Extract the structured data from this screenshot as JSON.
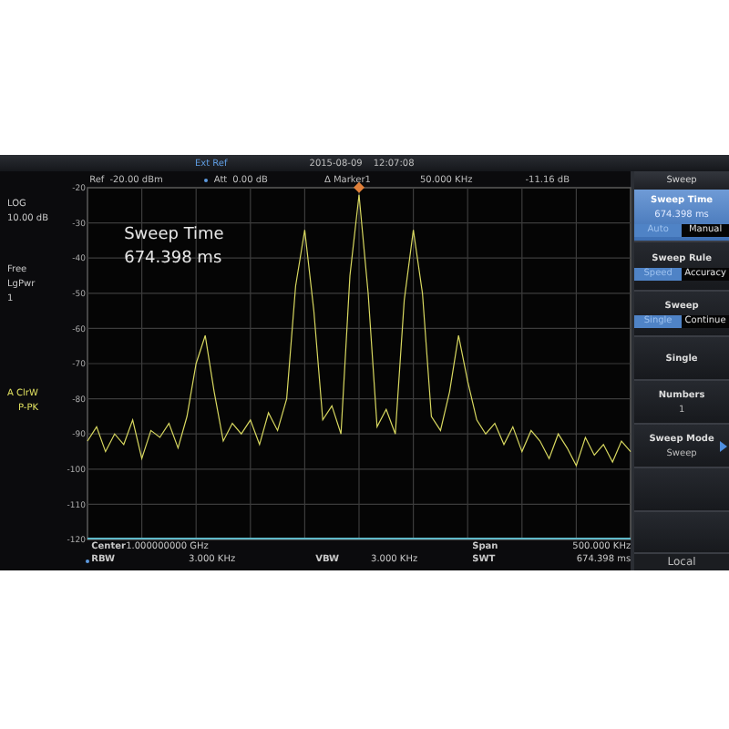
{
  "top_bar": {
    "reference": "Ext Ref",
    "date": "2015-08-09",
    "time": "12:07:08"
  },
  "left_panel": {
    "scale": "LOG",
    "scale_value": "10.00 dB",
    "trigger": "Free",
    "detector": "LgPwr",
    "average": "1",
    "trace_label": "A",
    "trace_mode": "ClrW",
    "trace_detector": "P-PK"
  },
  "plot": {
    "ref_label": "Ref",
    "ref_value": "-20.00 dBm",
    "att_label": "Att",
    "att_value": "0.00 dB",
    "marker_label": "Δ Marker1",
    "marker_freq": "50.000 KHz",
    "marker_value": "-11.16 dB",
    "chart_data": {
      "type": "line",
      "grid": true,
      "ylim": [
        -120,
        -20
      ],
      "yticks": [
        -20,
        -30,
        -40,
        -50,
        -60,
        -70,
        -80,
        -90,
        -100,
        -110,
        -120
      ],
      "categories": [
        null,
        null,
        null,
        null,
        null,
        null,
        null,
        null,
        null,
        null,
        null,
        null,
        null,
        null,
        null,
        null,
        null,
        null,
        null,
        null,
        null,
        null,
        null,
        null,
        null,
        null,
        null,
        null,
        null,
        null,
        null,
        null,
        null,
        null,
        null,
        null,
        null,
        null,
        null,
        null,
        null,
        null,
        null,
        null,
        null,
        null,
        null,
        null,
        null,
        null,
        null,
        null,
        null,
        null,
        null,
        null,
        null,
        null,
        null,
        null,
        null
      ],
      "series": [
        {
          "color": "#d8d860",
          "values": [
            -92,
            -88,
            -95,
            -90,
            -93,
            -86,
            -97,
            -89,
            -91,
            -87,
            -94,
            -85,
            -70,
            -62,
            -78,
            -92,
            -87,
            -90,
            -86,
            -93,
            -84,
            -89,
            -80,
            -48,
            -32,
            -55,
            -86,
            -82,
            -90,
            -45,
            -22,
            -50,
            -88,
            -83,
            -90,
            -52,
            -32,
            -50,
            -85,
            -89,
            -78,
            -62,
            -75,
            -86,
            -90,
            -87,
            -93,
            -88,
            -95,
            -89,
            -92,
            -97,
            -90,
            -94,
            -99,
            -91,
            -96,
            -93,
            -98,
            -92,
            -95
          ]
        }
      ]
    },
    "overlay_title": "Sweep Time",
    "overlay_value": "674.398 ms",
    "footer": [
      {
        "label": "Center",
        "value": "1.000000000 GHz",
        "label2": "Span",
        "value2": "500.000 KHz"
      },
      {
        "label": "RBW",
        "value": "3.000 KHz",
        "label_mid": "VBW",
        "value_mid": "3.000 KHz",
        "label2": "SWT",
        "value2": "674.398 ms"
      }
    ]
  },
  "menu": {
    "title": "Sweep",
    "items": [
      {
        "kind": "toggle",
        "label": "Sweep Time",
        "value": "674.398 ms",
        "selected": true,
        "options": [
          {
            "label": "Auto",
            "selected": true
          },
          {
            "label": "Manual",
            "selected": false
          }
        ]
      },
      {
        "kind": "toggle",
        "label": "Sweep Rule",
        "selected": false,
        "options": [
          {
            "label": "Speed",
            "selected": true
          },
          {
            "label": "Accuracy",
            "selected": false
          }
        ]
      },
      {
        "kind": "toggle",
        "label": "Sweep",
        "selected": false,
        "options": [
          {
            "label": "Single",
            "selected": true
          },
          {
            "label": "Continue",
            "selected": false
          }
        ]
      },
      {
        "kind": "button",
        "label": "Single",
        "selected": false
      },
      {
        "kind": "value",
        "label": "Numbers",
        "value": "1",
        "selected": false
      },
      {
        "kind": "submenu",
        "label": "Sweep Mode",
        "value": "Sweep",
        "selected": false
      },
      {
        "kind": "empty",
        "selected": false
      },
      {
        "kind": "empty",
        "selected": false
      }
    ],
    "footer": "Local"
  }
}
